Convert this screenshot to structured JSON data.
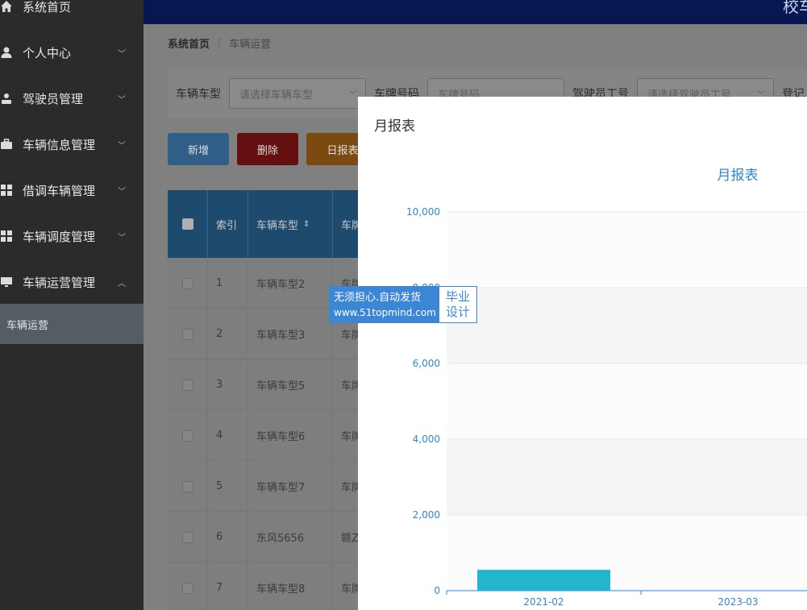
{
  "sidebar": {
    "items": [
      {
        "label": "系统首页",
        "icon": "home-icon",
        "chevron": ""
      },
      {
        "label": "个人中心",
        "icon": "user-icon",
        "chevron": "﹀"
      },
      {
        "label": "驾驶员管理",
        "icon": "driver-icon",
        "chevron": "﹀"
      },
      {
        "label": "车辆信息管理",
        "icon": "briefcase-icon",
        "chevron": "﹀"
      },
      {
        "label": "借调车辆管理",
        "icon": "grid-icon",
        "chevron": "﹀"
      },
      {
        "label": "车辆调度管理",
        "icon": "grid-icon",
        "chevron": "﹀"
      },
      {
        "label": "车辆运营管理",
        "icon": "monitor-icon",
        "chevron": "︿"
      }
    ],
    "submenu_active": "车辆运营"
  },
  "header": {
    "brand_fragment": "校车"
  },
  "breadcrumb": {
    "home": "系统首页",
    "separator": "⁝",
    "current": "车辆运营"
  },
  "filters": {
    "vehicle_type_label": "车辆车型",
    "vehicle_type_placeholder": "请选择车辆车型",
    "plate_label": "车牌号码",
    "plate_placeholder": "车牌号码",
    "driver_id_label": "驾驶员工号",
    "driver_id_placeholder": "请选择驾驶员工号",
    "register_label": "登记"
  },
  "toolbar": {
    "add_label": "新增",
    "delete_label": "删除",
    "daily_label": "日报表"
  },
  "table": {
    "headers": {
      "index": "索引",
      "vehicle_type": "车辆车型",
      "plate": "车牌"
    },
    "rows": [
      {
        "index": "1",
        "type": "车辆车型2",
        "plate": "车牌"
      },
      {
        "index": "2",
        "type": "车辆车型3",
        "plate": "车牌"
      },
      {
        "index": "3",
        "type": "车辆车型5",
        "plate": "车牌"
      },
      {
        "index": "4",
        "type": "车辆车型6",
        "plate": "车牌"
      },
      {
        "index": "5",
        "type": "车辆车型7",
        "plate": "车牌"
      },
      {
        "index": "6",
        "type": "东风5656",
        "plate": "赣Z"
      },
      {
        "index": "7",
        "type": "车辆车型8",
        "plate": "车牌"
      }
    ]
  },
  "modal": {
    "title": "月报表"
  },
  "badge": {
    "line1": "无须担心.自动发货",
    "url": "www.51topmind.com",
    "right_line1": "毕业",
    "right_line2": "设计"
  },
  "colors": {
    "accent_blue": "#2c8ad4",
    "bar": "#23b7ce",
    "danger": "#cc1818",
    "warning": "#e08310"
  },
  "chart_data": {
    "type": "bar",
    "title": "月报表",
    "categories": [
      "2021-02",
      "2023-03"
    ],
    "values": [
      550,
      0
    ],
    "yticks": [
      0,
      2000,
      4000,
      6000,
      8000,
      10000
    ],
    "ylim": [
      0,
      10000
    ],
    "grid": true
  }
}
